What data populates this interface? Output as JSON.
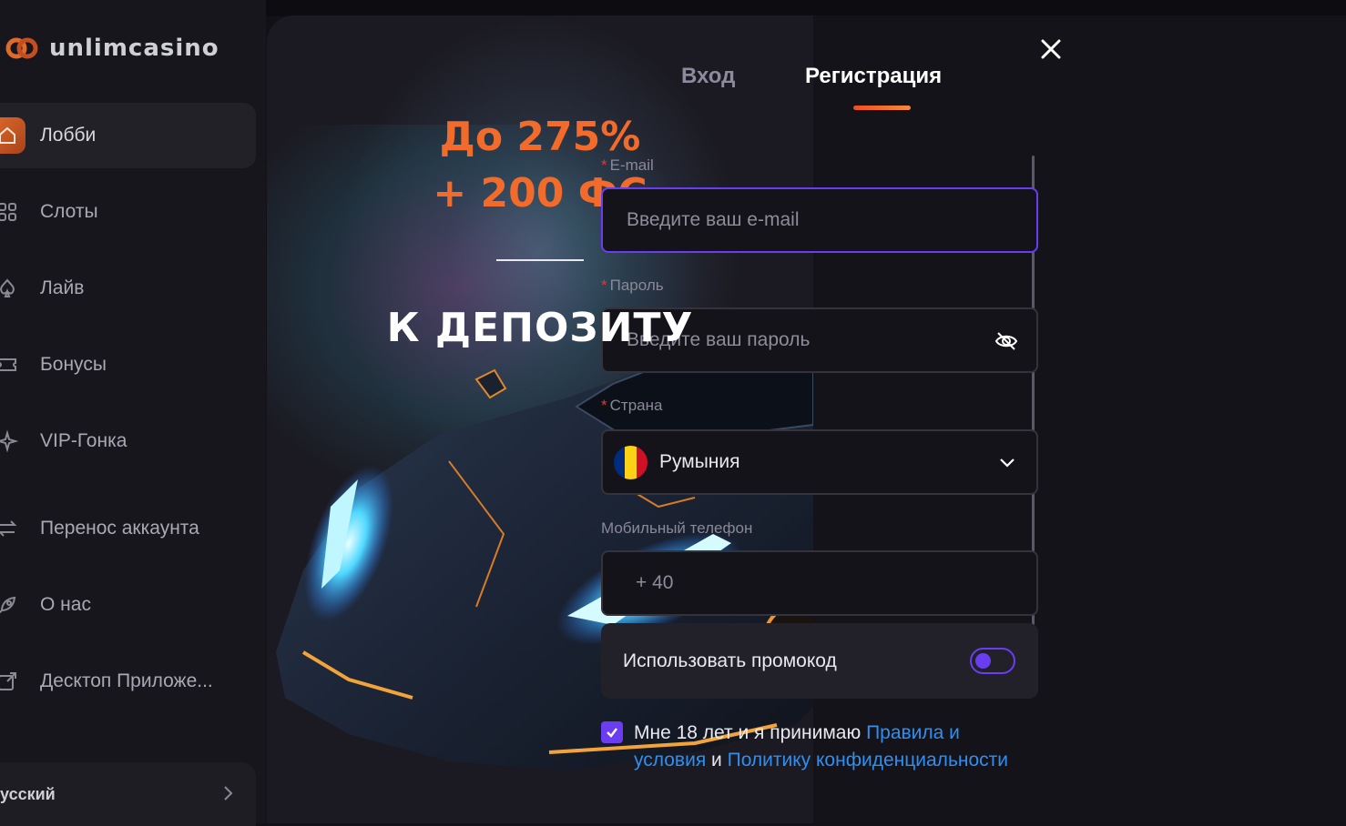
{
  "brand": {
    "name": "unlimcasino"
  },
  "sidebar": {
    "items": [
      {
        "label": "Лобби",
        "icon": "home-icon",
        "active": true
      },
      {
        "label": "Слоты",
        "icon": "grid-icon"
      },
      {
        "label": "Лайв",
        "icon": "spade-icon"
      },
      {
        "label": "Бонусы",
        "icon": "ticket-icon"
      },
      {
        "label": "VIP-Гонка",
        "icon": "star-icon"
      },
      {
        "label": "Перенос аккаунта",
        "icon": "transfer-icon"
      },
      {
        "label": "О нас",
        "icon": "rocket-icon"
      },
      {
        "label": "Десктоп Приложе...",
        "icon": "external-link-icon"
      }
    ],
    "language": "усский"
  },
  "promo": {
    "line1": "До 275%",
    "line2": "+ 200 ФС",
    "subtitle": "К ДЕПОЗИТУ"
  },
  "auth": {
    "tabs": {
      "login": "Вход",
      "register": "Регистрация"
    },
    "active_tab": "register",
    "email": {
      "label": "E-mail",
      "required": "*",
      "placeholder": "Введите ваш e-mail",
      "value": ""
    },
    "password": {
      "label": "Пароль",
      "required": "*",
      "placeholder": "Введите ваш пароль",
      "value": ""
    },
    "country": {
      "label": "Страна",
      "required": "*",
      "value": "Румыния",
      "flag_colors": [
        "#002b7f",
        "#fcd116",
        "#ce1126"
      ]
    },
    "phone": {
      "label": "Мобильный телефон",
      "prefix": "+ 40"
    },
    "promocode": {
      "label": "Использовать промокод",
      "enabled": false
    },
    "terms": {
      "checked": true,
      "text1": "Мне 18 лет и я принимаю ",
      "link1": "Правила и условия",
      "text2": " и ",
      "link2": "Политику конфиденциальности"
    }
  },
  "colors": {
    "accent": "#6a3ef0",
    "brand_orange": "#f26b2b",
    "link": "#2f8ff0",
    "required": "#e2363c"
  }
}
